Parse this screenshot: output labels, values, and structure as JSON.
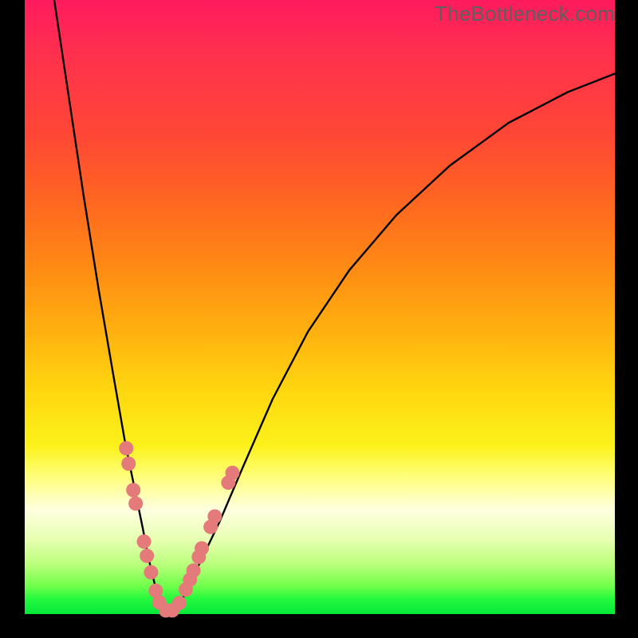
{
  "watermark": {
    "text": "TheBottleneck.com"
  },
  "palette": {
    "curve_stroke": "#000000",
    "marker_fill": "#e47a7a",
    "marker_stroke": "#cf5f5f"
  },
  "chart_data": {
    "type": "line",
    "title": "",
    "xlabel": "",
    "ylabel": "",
    "xlim": [
      0,
      100
    ],
    "ylim": [
      0,
      100
    ],
    "grid": false,
    "legend": false,
    "series": [
      {
        "name": "bottleneck-curve",
        "x": [
          5,
          7.5,
          10,
          12.5,
          15,
          17,
          18.5,
          20,
          21,
          22,
          23,
          24,
          25,
          26.5,
          28,
          30,
          33,
          37,
          42,
          48,
          55,
          63,
          72,
          82,
          92,
          100
        ],
        "y": [
          100,
          84,
          68,
          53,
          39,
          28,
          21,
          14,
          9,
          5,
          2,
          0.5,
          0.5,
          2,
          5,
          9,
          15,
          24,
          35,
          46,
          56,
          65,
          73,
          80,
          85,
          88
        ]
      }
    ],
    "markers": [
      {
        "x": 17.2,
        "y": 27.0
      },
      {
        "x": 17.6,
        "y": 24.5
      },
      {
        "x": 18.4,
        "y": 20.2
      },
      {
        "x": 18.8,
        "y": 18.0
      },
      {
        "x": 20.2,
        "y": 11.8
      },
      {
        "x": 20.7,
        "y": 9.5
      },
      {
        "x": 21.4,
        "y": 6.8
      },
      {
        "x": 22.2,
        "y": 3.8
      },
      {
        "x": 22.8,
        "y": 1.9
      },
      {
        "x": 23.9,
        "y": 0.6
      },
      {
        "x": 25.0,
        "y": 0.6
      },
      {
        "x": 26.2,
        "y": 1.8
      },
      {
        "x": 27.3,
        "y": 4.0
      },
      {
        "x": 28.0,
        "y": 5.6
      },
      {
        "x": 28.6,
        "y": 7.1
      },
      {
        "x": 29.5,
        "y": 9.3
      },
      {
        "x": 30.0,
        "y": 10.7
      },
      {
        "x": 31.5,
        "y": 14.2
      },
      {
        "x": 32.2,
        "y": 15.9
      },
      {
        "x": 34.5,
        "y": 21.4
      },
      {
        "x": 35.2,
        "y": 23.0
      }
    ]
  }
}
